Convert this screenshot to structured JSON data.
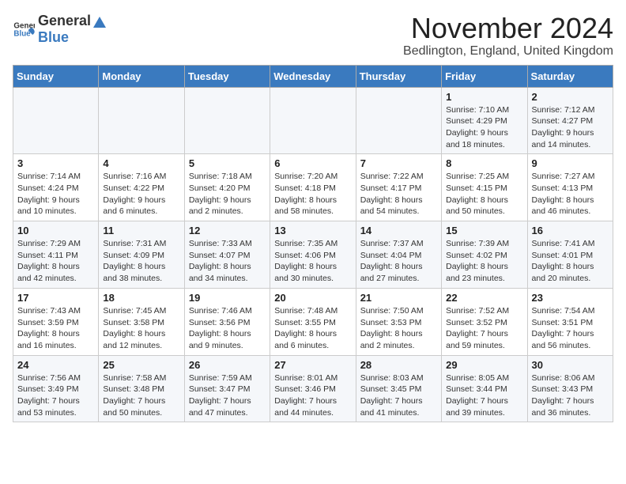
{
  "header": {
    "logo_general": "General",
    "logo_blue": "Blue",
    "month": "November 2024",
    "location": "Bedlington, England, United Kingdom"
  },
  "days_of_week": [
    "Sunday",
    "Monday",
    "Tuesday",
    "Wednesday",
    "Thursday",
    "Friday",
    "Saturday"
  ],
  "weeks": [
    [
      {
        "day": "",
        "info": ""
      },
      {
        "day": "",
        "info": ""
      },
      {
        "day": "",
        "info": ""
      },
      {
        "day": "",
        "info": ""
      },
      {
        "day": "",
        "info": ""
      },
      {
        "day": "1",
        "info": "Sunrise: 7:10 AM\nSunset: 4:29 PM\nDaylight: 9 hours and 18 minutes."
      },
      {
        "day": "2",
        "info": "Sunrise: 7:12 AM\nSunset: 4:27 PM\nDaylight: 9 hours and 14 minutes."
      }
    ],
    [
      {
        "day": "3",
        "info": "Sunrise: 7:14 AM\nSunset: 4:24 PM\nDaylight: 9 hours and 10 minutes."
      },
      {
        "day": "4",
        "info": "Sunrise: 7:16 AM\nSunset: 4:22 PM\nDaylight: 9 hours and 6 minutes."
      },
      {
        "day": "5",
        "info": "Sunrise: 7:18 AM\nSunset: 4:20 PM\nDaylight: 9 hours and 2 minutes."
      },
      {
        "day": "6",
        "info": "Sunrise: 7:20 AM\nSunset: 4:18 PM\nDaylight: 8 hours and 58 minutes."
      },
      {
        "day": "7",
        "info": "Sunrise: 7:22 AM\nSunset: 4:17 PM\nDaylight: 8 hours and 54 minutes."
      },
      {
        "day": "8",
        "info": "Sunrise: 7:25 AM\nSunset: 4:15 PM\nDaylight: 8 hours and 50 minutes."
      },
      {
        "day": "9",
        "info": "Sunrise: 7:27 AM\nSunset: 4:13 PM\nDaylight: 8 hours and 46 minutes."
      }
    ],
    [
      {
        "day": "10",
        "info": "Sunrise: 7:29 AM\nSunset: 4:11 PM\nDaylight: 8 hours and 42 minutes."
      },
      {
        "day": "11",
        "info": "Sunrise: 7:31 AM\nSunset: 4:09 PM\nDaylight: 8 hours and 38 minutes."
      },
      {
        "day": "12",
        "info": "Sunrise: 7:33 AM\nSunset: 4:07 PM\nDaylight: 8 hours and 34 minutes."
      },
      {
        "day": "13",
        "info": "Sunrise: 7:35 AM\nSunset: 4:06 PM\nDaylight: 8 hours and 30 minutes."
      },
      {
        "day": "14",
        "info": "Sunrise: 7:37 AM\nSunset: 4:04 PM\nDaylight: 8 hours and 27 minutes."
      },
      {
        "day": "15",
        "info": "Sunrise: 7:39 AM\nSunset: 4:02 PM\nDaylight: 8 hours and 23 minutes."
      },
      {
        "day": "16",
        "info": "Sunrise: 7:41 AM\nSunset: 4:01 PM\nDaylight: 8 hours and 20 minutes."
      }
    ],
    [
      {
        "day": "17",
        "info": "Sunrise: 7:43 AM\nSunset: 3:59 PM\nDaylight: 8 hours and 16 minutes."
      },
      {
        "day": "18",
        "info": "Sunrise: 7:45 AM\nSunset: 3:58 PM\nDaylight: 8 hours and 12 minutes."
      },
      {
        "day": "19",
        "info": "Sunrise: 7:46 AM\nSunset: 3:56 PM\nDaylight: 8 hours and 9 minutes."
      },
      {
        "day": "20",
        "info": "Sunrise: 7:48 AM\nSunset: 3:55 PM\nDaylight: 8 hours and 6 minutes."
      },
      {
        "day": "21",
        "info": "Sunrise: 7:50 AM\nSunset: 3:53 PM\nDaylight: 8 hours and 2 minutes."
      },
      {
        "day": "22",
        "info": "Sunrise: 7:52 AM\nSunset: 3:52 PM\nDaylight: 7 hours and 59 minutes."
      },
      {
        "day": "23",
        "info": "Sunrise: 7:54 AM\nSunset: 3:51 PM\nDaylight: 7 hours and 56 minutes."
      }
    ],
    [
      {
        "day": "24",
        "info": "Sunrise: 7:56 AM\nSunset: 3:49 PM\nDaylight: 7 hours and 53 minutes."
      },
      {
        "day": "25",
        "info": "Sunrise: 7:58 AM\nSunset: 3:48 PM\nDaylight: 7 hours and 50 minutes."
      },
      {
        "day": "26",
        "info": "Sunrise: 7:59 AM\nSunset: 3:47 PM\nDaylight: 7 hours and 47 minutes."
      },
      {
        "day": "27",
        "info": "Sunrise: 8:01 AM\nSunset: 3:46 PM\nDaylight: 7 hours and 44 minutes."
      },
      {
        "day": "28",
        "info": "Sunrise: 8:03 AM\nSunset: 3:45 PM\nDaylight: 7 hours and 41 minutes."
      },
      {
        "day": "29",
        "info": "Sunrise: 8:05 AM\nSunset: 3:44 PM\nDaylight: 7 hours and 39 minutes."
      },
      {
        "day": "30",
        "info": "Sunrise: 8:06 AM\nSunset: 3:43 PM\nDaylight: 7 hours and 36 minutes."
      }
    ]
  ]
}
